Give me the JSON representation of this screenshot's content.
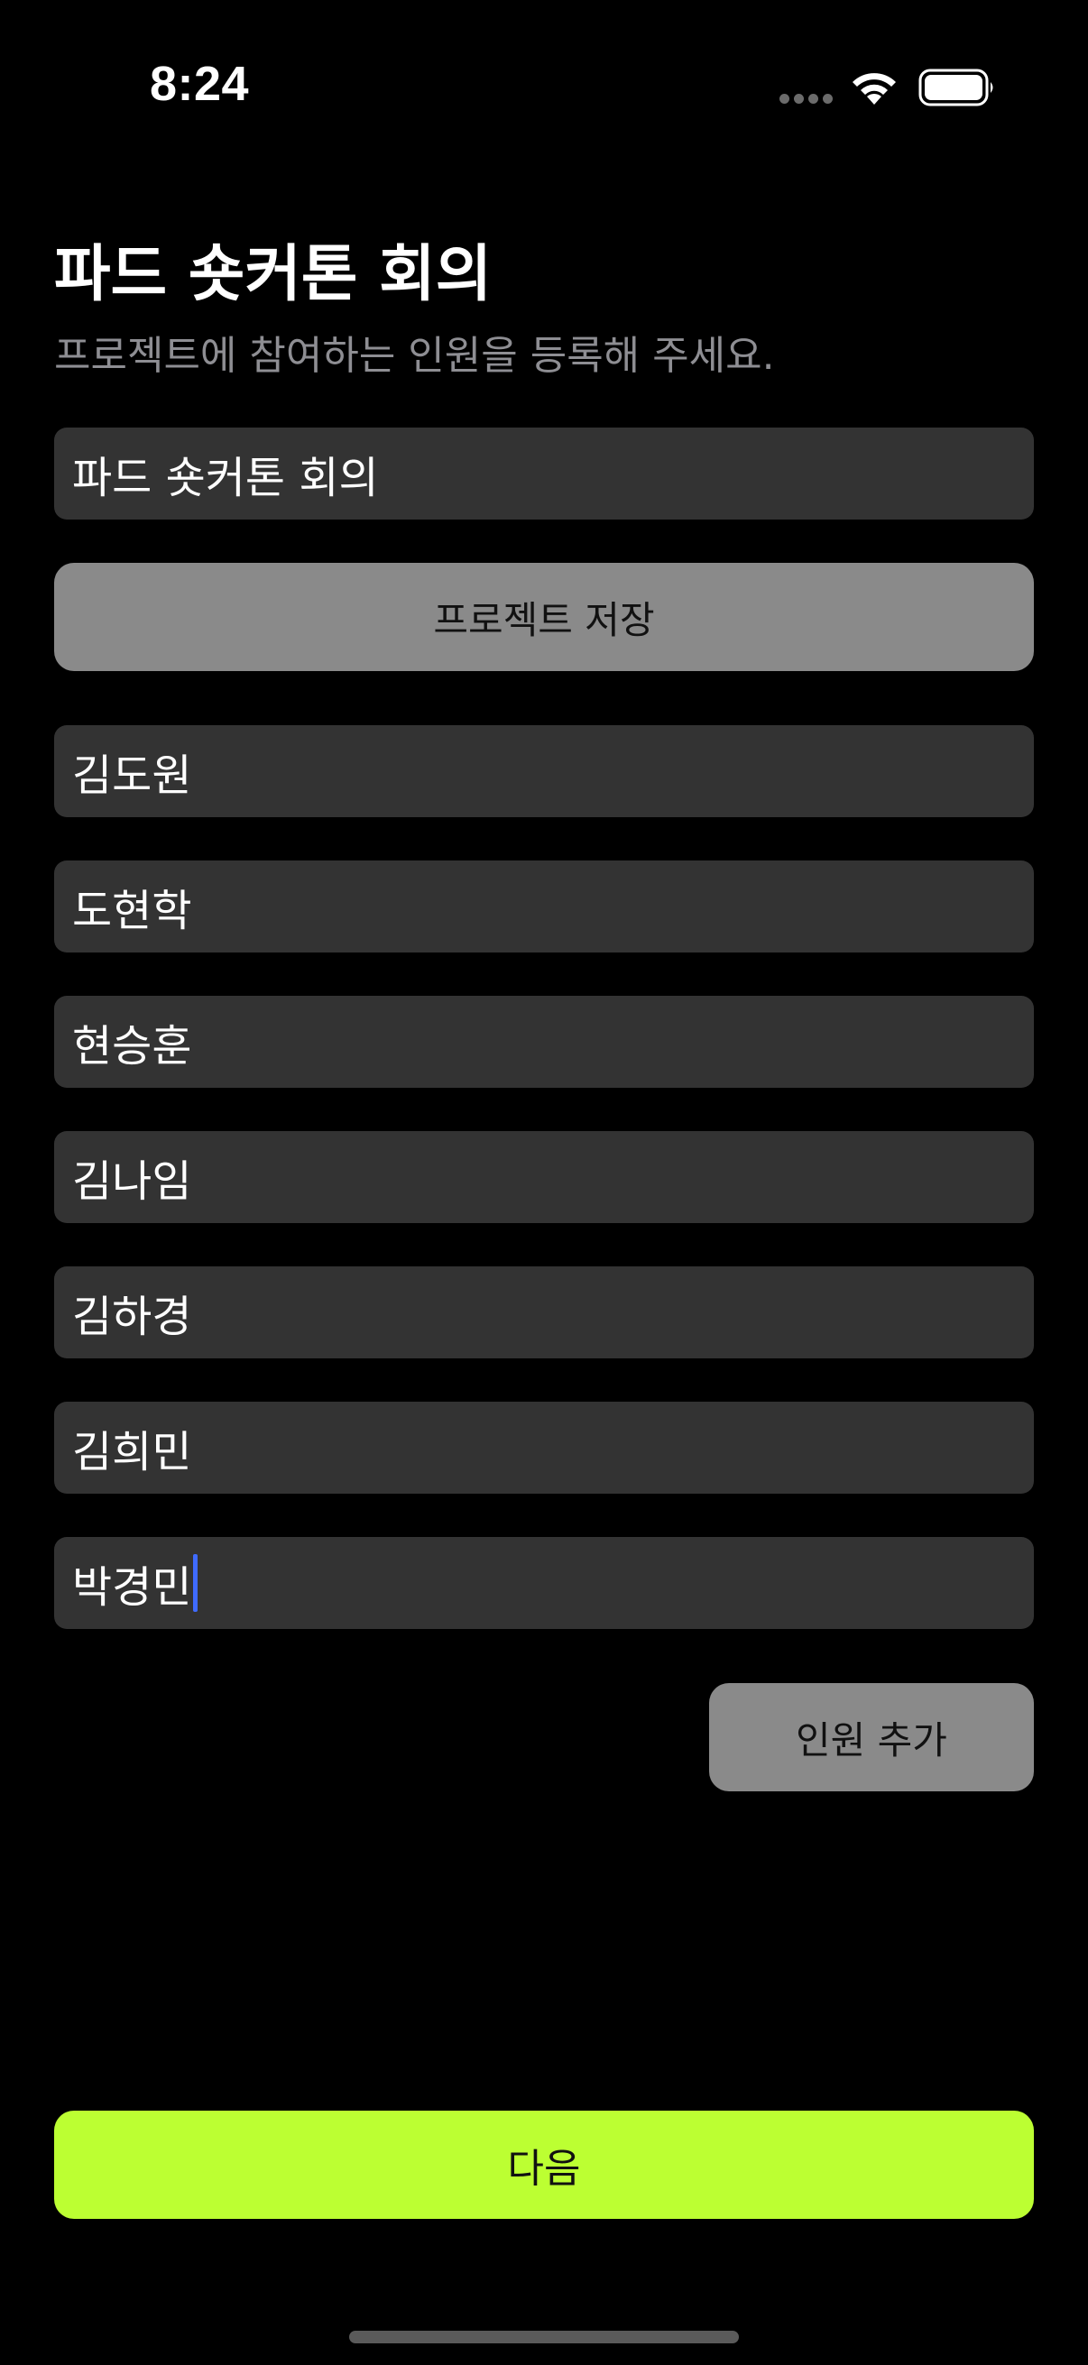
{
  "status_bar": {
    "time": "8:24",
    "icons": [
      "signal-dots-icon",
      "wifi-icon",
      "battery-icon"
    ]
  },
  "header": {
    "title": "파드 숏커톤 회의",
    "subtitle": "프로젝트에 참여하는 인원을 등록해 주세요."
  },
  "project": {
    "name_value": "파드 숏커톤 회의",
    "save_label": "프로젝트 저장"
  },
  "members": [
    "김도원",
    "도현학",
    "현승훈",
    "김나임",
    "김하경",
    "김희민",
    "박경민"
  ],
  "actions": {
    "add_member_label": "인원 추가",
    "next_label": "다음"
  },
  "colors": {
    "background": "#000000",
    "field": "#333333",
    "gray_button": "#8a8a8a",
    "accent": "#bcff32",
    "caret": "#3f6bff"
  }
}
